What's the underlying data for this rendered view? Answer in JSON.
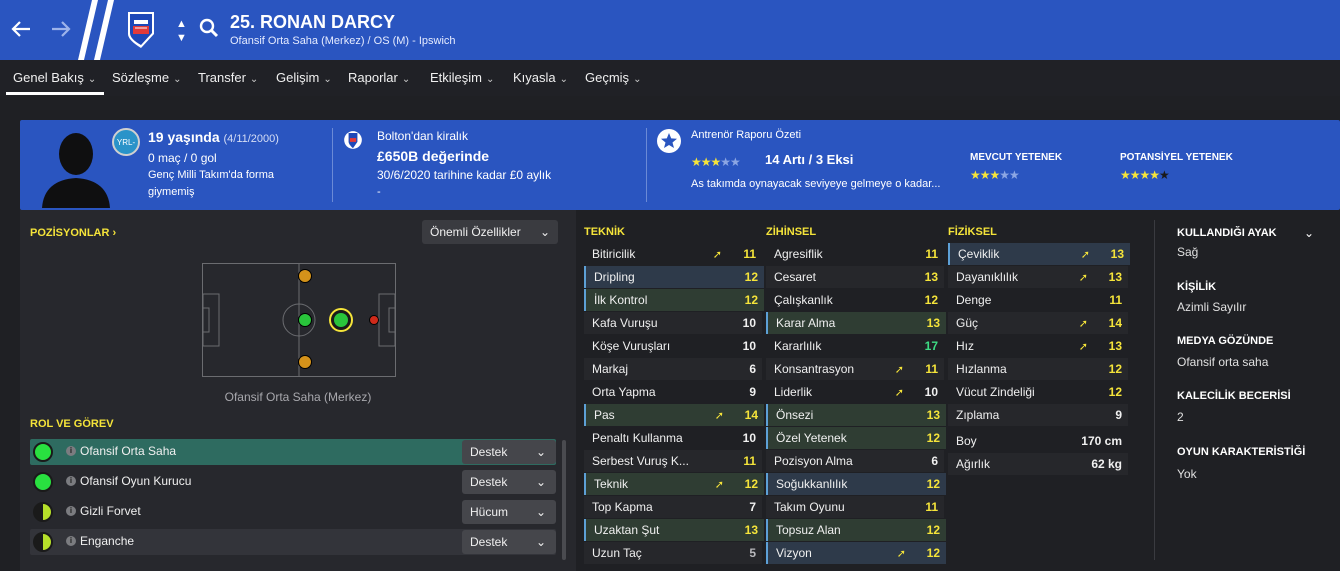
{
  "header": {
    "title": "25. RONAN DARCY",
    "subtitle": "Ofansif Orta Saha (Merkez) / OS (M) - Ipswich"
  },
  "menu": [
    {
      "label": "Genel Bakış"
    },
    {
      "label": "Sözleşme"
    },
    {
      "label": "Transfer"
    },
    {
      "label": "Gelişim"
    },
    {
      "label": "Raporlar"
    },
    {
      "label": "Etkileşim"
    },
    {
      "label": "Kıyasla"
    },
    {
      "label": "Geçmiş"
    }
  ],
  "profile": {
    "age": "19 yaşında",
    "birth": "(4/11/2000)",
    "apps": "0 maç / 0 gol",
    "intl_line1": "Genç Milli Takım'da forma",
    "intl_line2": "giymemiş",
    "badge_text": "YRL-",
    "loan": "Bolton'dan kiralık",
    "value": "£650B değerinde",
    "contract": "30/6/2020 tarihine kadar £0 aylık",
    "contract_extra": "-",
    "report_title": "Antrenör Raporu Özeti",
    "report_summary": "14 Artı / 3 Eksi",
    "report_text": "As takımda oynayacak seviyeye gelmeye o kadar...",
    "report_stars": 3,
    "current_ability_label": "MEVCUT YETENEK",
    "current_ability_stars": 3,
    "potential_ability_label": "POTANSİYEL YETENEK",
    "potential_ability_stars": 4.5
  },
  "positions": {
    "title": "POZİSYONLAR",
    "dropdown": "Önemli Özellikler",
    "position_label": "Ofansif Orta Saha (Merkez)"
  },
  "roles": {
    "title": "ROL VE GÖREV",
    "items": [
      {
        "name": "Ofansif Orta Saha",
        "duty": "Destek"
      },
      {
        "name": "Ofansif Oyun Kurucu",
        "duty": "Destek"
      },
      {
        "name": "Gizli Forvet",
        "duty": "Hücum"
      },
      {
        "name": "Enganche",
        "duty": "Destek"
      }
    ]
  },
  "attributes": {
    "technical_title": "TEKNİK",
    "mental_title": "ZİHİNSEL",
    "physical_title": "FİZİKSEL",
    "technical": [
      {
        "name": "Bitiricilik",
        "value": "11"
      },
      {
        "name": "Dripling",
        "value": "12"
      },
      {
        "name": "İlk Kontrol",
        "value": "12"
      },
      {
        "name": "Kafa Vuruşu",
        "value": "10"
      },
      {
        "name": "Köşe Vuruşları",
        "value": "10"
      },
      {
        "name": "Markaj",
        "value": "6"
      },
      {
        "name": "Orta Yapma",
        "value": "9"
      },
      {
        "name": "Pas",
        "value": "14"
      },
      {
        "name": "Penaltı Kullanma",
        "value": "10"
      },
      {
        "name": "Serbest Vuruş K...",
        "value": "11"
      },
      {
        "name": "Teknik",
        "value": "12"
      },
      {
        "name": "Top Kapma",
        "value": "7"
      },
      {
        "name": "Uzaktan Şut",
        "value": "13"
      },
      {
        "name": "Uzun Taç",
        "value": "5"
      }
    ],
    "mental": [
      {
        "name": "Agresiflik",
        "value": "11"
      },
      {
        "name": "Cesaret",
        "value": "13"
      },
      {
        "name": "Çalışkanlık",
        "value": "12"
      },
      {
        "name": "Karar Alma",
        "value": "13"
      },
      {
        "name": "Kararlılık",
        "value": "17"
      },
      {
        "name": "Konsantrasyon",
        "value": "11"
      },
      {
        "name": "Liderlik",
        "value": "10"
      },
      {
        "name": "Önsezi",
        "value": "13"
      },
      {
        "name": "Özel Yetenek",
        "value": "12"
      },
      {
        "name": "Pozisyon Alma",
        "value": "6"
      },
      {
        "name": "Soğukkanlılık",
        "value": "12"
      },
      {
        "name": "Takım Oyunu",
        "value": "11"
      },
      {
        "name": "Topsuz Alan",
        "value": "12"
      },
      {
        "name": "Vizyon",
        "value": "12"
      }
    ],
    "physical": [
      {
        "name": "Çeviklik",
        "value": "13"
      },
      {
        "name": "Dayanıklılık",
        "value": "13"
      },
      {
        "name": "Denge",
        "value": "11"
      },
      {
        "name": "Güç",
        "value": "14"
      },
      {
        "name": "Hız",
        "value": "13"
      },
      {
        "name": "Hızlanma",
        "value": "12"
      },
      {
        "name": "Vücut Zindeliği",
        "value": "12"
      },
      {
        "name": "Zıplama",
        "value": "9"
      },
      {
        "name": "Boy",
        "value": "170 cm"
      },
      {
        "name": "Ağırlık",
        "value": "62 kg"
      }
    ]
  },
  "info": {
    "foot_label": "KULLANDIĞI AYAK",
    "foot_value": "Sağ",
    "personality_label": "KİŞİLİK",
    "personality_value": "Azimli Sayılır",
    "media_label": "MEDYA GÖZÜNDE",
    "media_value": "Ofansif orta saha",
    "gk_label": "KALECİLİK BECERİSİ",
    "gk_value": "2",
    "traits_label": "OYUN KARAKTERİSTİĞİ",
    "traits_value": "Yok"
  },
  "colors": {
    "accent": "#2a55c0",
    "highlight_yellow": "#f5e43a",
    "value_green": "#3ddc84"
  }
}
